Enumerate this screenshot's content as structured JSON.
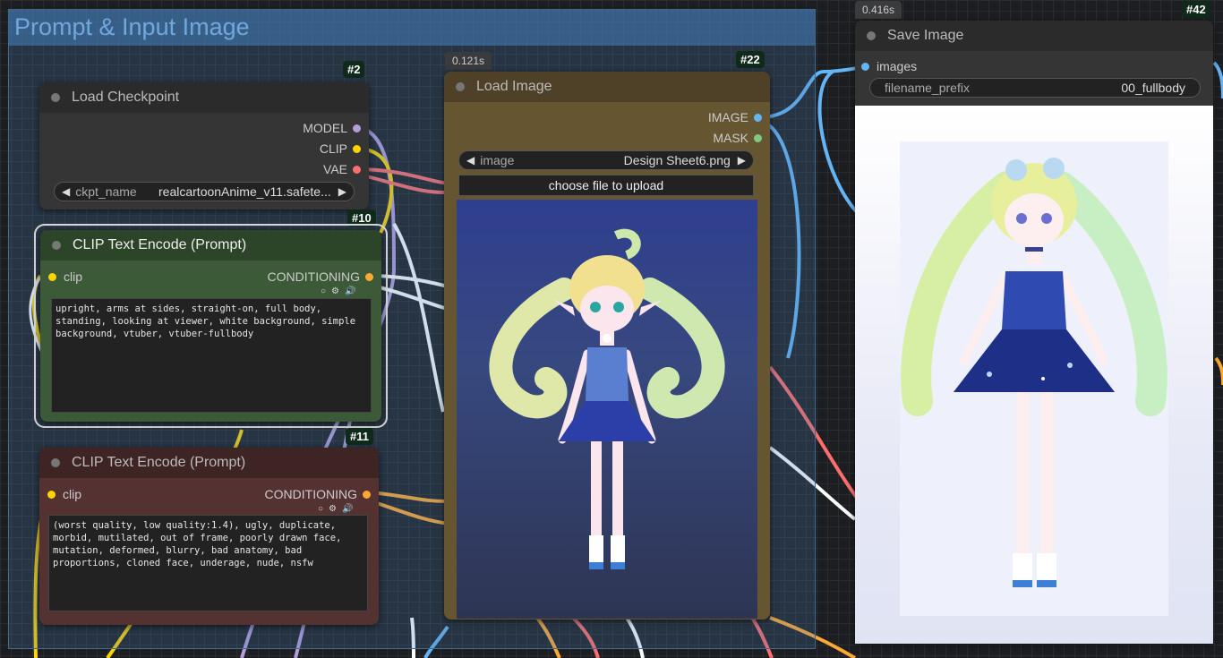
{
  "group": {
    "title": "Prompt & Input Image"
  },
  "nodes": {
    "load_checkpoint": {
      "id": "#2",
      "title": "Load Checkpoint",
      "outputs": [
        "MODEL",
        "CLIP",
        "VAE"
      ],
      "widget": {
        "label": "ckpt_name",
        "value": "realcartoonAnime_v11.safete..."
      }
    },
    "clip_pos": {
      "id": "#10",
      "title": "CLIP Text Encode (Prompt)",
      "input": "clip",
      "output": "CONDITIONING",
      "text": "upright, arms at sides, straight-on, full body, standing, looking at viewer, white background, simple background, vtuber, vtuber-fullbody"
    },
    "clip_neg": {
      "id": "#11",
      "title": "CLIP Text Encode (Prompt)",
      "input": "clip",
      "output": "CONDITIONING",
      "text": "(worst quality, low quality:1.4), ugly, duplicate, morbid, mutilated, out of frame, poorly drawn face, mutation, deformed, blurry, bad anatomy, bad proportions, cloned face, underage, nude, nsfw"
    },
    "load_image": {
      "id": "#22",
      "timing": "0.121s",
      "title": "Load Image",
      "outputs": [
        "IMAGE",
        "MASK"
      ],
      "widget": {
        "label": "image",
        "value": "Design Sheet6.png"
      },
      "upload_label": "choose file to upload"
    },
    "save_image": {
      "id": "#42",
      "timing": "0.416s",
      "title": "Save Image",
      "input": "images",
      "widget": {
        "label": "filename_prefix",
        "value": "00_fullbody"
      }
    }
  },
  "icons": [
    "settings-gear-icon",
    "speaker-icon",
    "circle-toggle-icon",
    "left-arrow-icon",
    "right-arrow-icon"
  ],
  "colors": {
    "model_slot": "#b39ddb",
    "clip_slot": "#ffd500",
    "vae_slot": "#ff6e6e",
    "conditioning_slot": "#ffa931",
    "image_slot": "#64b5f6",
    "mask_slot": "#81c784",
    "group_title": "#6fa8dc"
  }
}
